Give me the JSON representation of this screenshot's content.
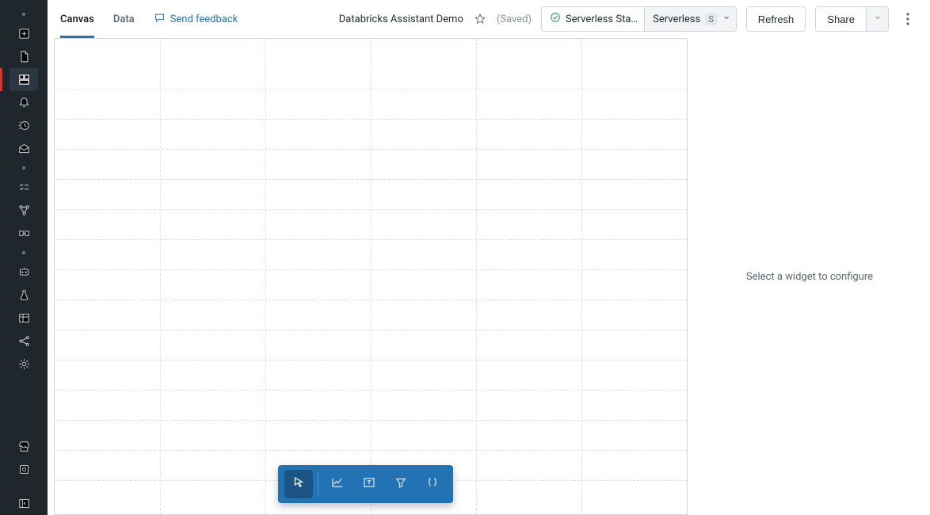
{
  "sidebar": {
    "items_top": [
      {
        "name": "new-icon"
      },
      {
        "name": "sql-file-icon"
      },
      {
        "name": "dashboard-icon"
      },
      {
        "name": "alerts-icon"
      },
      {
        "name": "history-icon"
      },
      {
        "name": "warehouse-icon"
      }
    ],
    "items_mid": [
      {
        "name": "checklist-icon"
      },
      {
        "name": "workflows-icon"
      },
      {
        "name": "pipelines-icon"
      }
    ],
    "items_lower": [
      {
        "name": "ai-assistant-icon"
      },
      {
        "name": "experiments-icon"
      },
      {
        "name": "tables-icon"
      },
      {
        "name": "graph-icon"
      },
      {
        "name": "settings-icon"
      }
    ],
    "items_bottom": [
      {
        "name": "marketplace-icon"
      },
      {
        "name": "models-icon"
      }
    ],
    "item_footer": {
      "name": "collapse-sidebar-icon"
    },
    "active": "dashboard-icon"
  },
  "tabs": [
    {
      "id": "canvas",
      "label": "Canvas",
      "active": true
    },
    {
      "id": "data",
      "label": "Data",
      "active": false
    }
  ],
  "feedback_label": "Send feedback",
  "doc_title": "Databricks Assistant Demo",
  "saved_label": "(Saved)",
  "compute": {
    "status_label": "Serverless Sta…",
    "name": "Serverless",
    "badge": "S"
  },
  "refresh_label": "Refresh",
  "share_label": "Share",
  "right_panel_placeholder": "Select a widget to configure",
  "widget_toolbar": {
    "items": [
      {
        "name": "cursor-tool",
        "active": true
      },
      {
        "name": "chart-tool",
        "active": false
      },
      {
        "name": "text-tool",
        "active": false
      },
      {
        "name": "filter-tool",
        "active": false
      },
      {
        "name": "code-tool",
        "active": false
      }
    ]
  }
}
